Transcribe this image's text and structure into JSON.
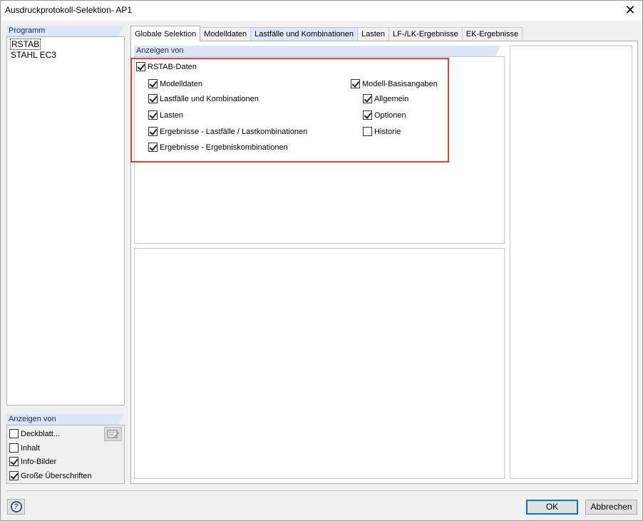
{
  "window": {
    "title": "Ausdruckprotokoll-Selektion- AP1",
    "close_glyph": "✕"
  },
  "program_group": {
    "header": "Programm",
    "items": [
      {
        "label": "RSTAB",
        "selected": true
      },
      {
        "label": "STAHL EC3",
        "selected": false
      }
    ]
  },
  "display_group": {
    "header": "Anzeigen von",
    "items": [
      {
        "label": "Deckblatt...",
        "checked": false
      },
      {
        "label": "Inhalt",
        "checked": false
      },
      {
        "label": "Info-Bilder",
        "checked": true
      },
      {
        "label": "Große Überschriften",
        "checked": true
      }
    ],
    "edit_icon": "edit-cover-icon"
  },
  "tabs": [
    {
      "label": "Globale Selektion",
      "active": true,
      "highlighted": false
    },
    {
      "label": "Modelldaten",
      "active": false,
      "highlighted": false
    },
    {
      "label": "Lastfälle und Kombinationen",
      "active": false,
      "highlighted": true
    },
    {
      "label": "Lasten",
      "active": false,
      "highlighted": false
    },
    {
      "label": "LF-/LK-Ergebnisse",
      "active": false,
      "highlighted": false
    },
    {
      "label": "EK-Ergebnisse",
      "active": false,
      "highlighted": false
    }
  ],
  "global_selection": {
    "header": "Anzeigen von",
    "master": {
      "label": "RSTAB-Daten",
      "checked": true
    },
    "left": [
      {
        "label": "Modelldaten",
        "checked": true
      },
      {
        "label": "Lastfälle und Kombinationen",
        "checked": true
      },
      {
        "label": "Lasten",
        "checked": true
      },
      {
        "label": "Ergebnisse - Lastfälle / Lastkombinationen",
        "checked": true
      },
      {
        "label": "Ergebnisse - Ergebniskombinationen",
        "checked": true
      }
    ],
    "right_master": {
      "label": "Modell-Basisangaben",
      "checked": true
    },
    "right": [
      {
        "label": "Allgemein",
        "checked": true
      },
      {
        "label": "Optionen",
        "checked": true
      },
      {
        "label": "Historie",
        "checked": false
      }
    ]
  },
  "footer": {
    "ok_label": "OK",
    "cancel_label": "Abbrechen",
    "help_glyph": "?"
  },
  "colors": {
    "accent": "#0078d7",
    "header_band": "#dce6f7",
    "highlight_frame": "#e0403c"
  }
}
